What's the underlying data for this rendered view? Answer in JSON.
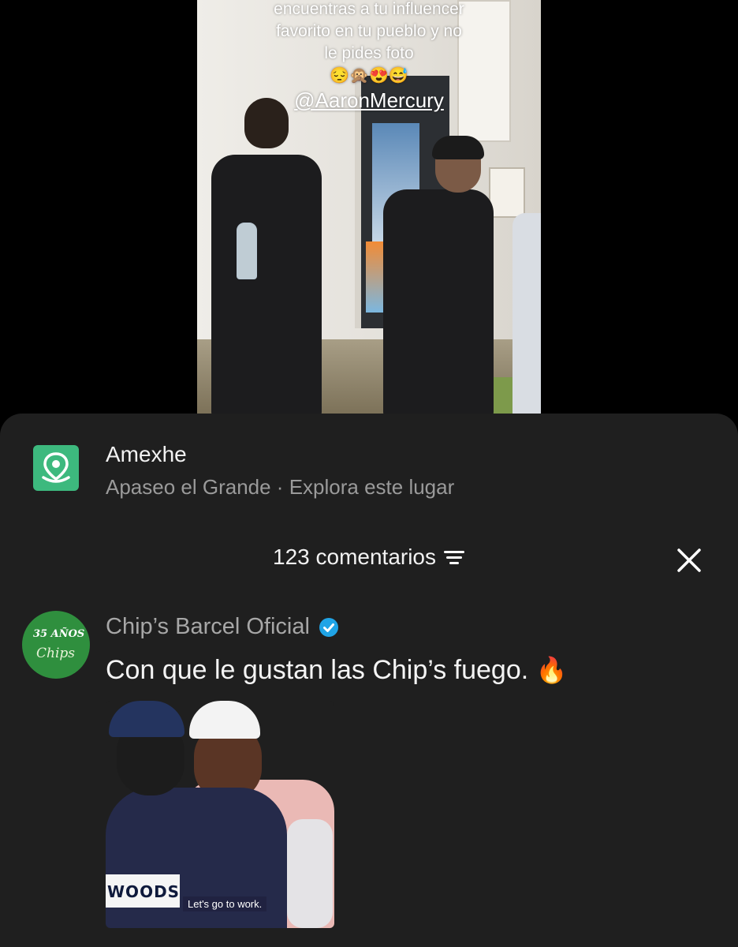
{
  "video": {
    "overlay_lines": [
      "encuentras a tu influencer",
      "favorito en tu pueblo y no",
      "le pides foto"
    ],
    "overlay_emoji": "😔🙊😍😅",
    "mention": "@AaronMercury"
  },
  "location": {
    "icon": "map-pin-icon",
    "title": "Amexhe",
    "subtitle": "Apaseo el Grande · Explora este lugar",
    "icon_color": "#3db97e"
  },
  "comments_header": {
    "count_label": "123 comentarios",
    "filter_icon": "filter-icon",
    "close_icon": "close-icon"
  },
  "comment": {
    "author": "Chip’s Barcel Oficial",
    "verified": true,
    "avatar_text": "35 AÑOS",
    "avatar_brand": "Chips",
    "text": "Con que le gustan las Chip’s fuego.",
    "emoji": "🔥",
    "gif": {
      "bib_text": "WOODS",
      "caption": "Let's go to work."
    }
  },
  "colors": {
    "sheet_bg": "#1f1f1f",
    "muted_text": "#9a9a9a",
    "verified": "#20a4e6",
    "avatar_bg": "#2f8f3e"
  }
}
